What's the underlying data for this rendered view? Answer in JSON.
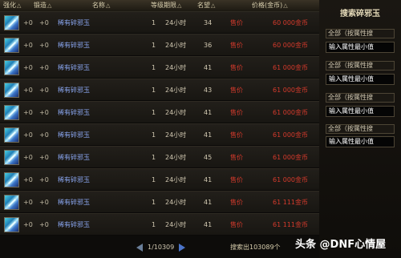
{
  "header": {
    "enhance": "强化",
    "refine": "锻造",
    "name": "名称",
    "level_time": "等级期限",
    "fame": "名望",
    "price": "价格(金币)",
    "sort_arrow": "△"
  },
  "rows": [
    {
      "enh": "+0",
      "ref": "+0",
      "name": "稀有碎邪玉",
      "qty": "1",
      "dur": "24小时",
      "fame": "34",
      "sell": "售价",
      "price": "60 000金币"
    },
    {
      "enh": "+0",
      "ref": "+0",
      "name": "稀有碎邪玉",
      "qty": "1",
      "dur": "24小时",
      "fame": "36",
      "sell": "售价",
      "price": "60 000金币"
    },
    {
      "enh": "+0",
      "ref": "+0",
      "name": "稀有碎邪玉",
      "qty": "1",
      "dur": "24小时",
      "fame": "41",
      "sell": "售价",
      "price": "61 000金币"
    },
    {
      "enh": "+0",
      "ref": "+0",
      "name": "稀有碎邪玉",
      "qty": "1",
      "dur": "24小时",
      "fame": "43",
      "sell": "售价",
      "price": "61 000金币"
    },
    {
      "enh": "+0",
      "ref": "+0",
      "name": "稀有碎邪玉",
      "qty": "1",
      "dur": "24小时",
      "fame": "41",
      "sell": "售价",
      "price": "61 000金币"
    },
    {
      "enh": "+0",
      "ref": "+0",
      "name": "稀有碎邪玉",
      "qty": "1",
      "dur": "24小时",
      "fame": "41",
      "sell": "售价",
      "price": "61 000金币"
    },
    {
      "enh": "+0",
      "ref": "+0",
      "name": "稀有碎邪玉",
      "qty": "1",
      "dur": "24小时",
      "fame": "45",
      "sell": "售价",
      "price": "61 000金币"
    },
    {
      "enh": "+0",
      "ref": "+0",
      "name": "稀有碎邪玉",
      "qty": "1",
      "dur": "24小时",
      "fame": "41",
      "sell": "售价",
      "price": "61 000金币"
    },
    {
      "enh": "+0",
      "ref": "+0",
      "name": "稀有碎邪玉",
      "qty": "1",
      "dur": "24小时",
      "fame": "41",
      "sell": "售价",
      "price": "61 111金币"
    },
    {
      "enh": "+0",
      "ref": "+0",
      "name": "稀有碎邪玉",
      "qty": "1",
      "dur": "24小时",
      "fame": "41",
      "sell": "售价",
      "price": "61 111金币"
    }
  ],
  "pager": {
    "page": "1/10309",
    "search_count": "搜索出103089个"
  },
  "sidebar": {
    "title": "搜索碎邪玉",
    "filters": [
      {
        "select": "全部（按属性搜",
        "input": "输入属性最小值"
      },
      {
        "select": "全部（按属性搜",
        "input": "输入属性最小值"
      },
      {
        "select": "全部（按属性搜",
        "input": "输入属性最小值"
      },
      {
        "select": "全部（按属性搜",
        "input": "输入属性最小值"
      }
    ]
  },
  "watermark": "头条 @DNF心情屋"
}
